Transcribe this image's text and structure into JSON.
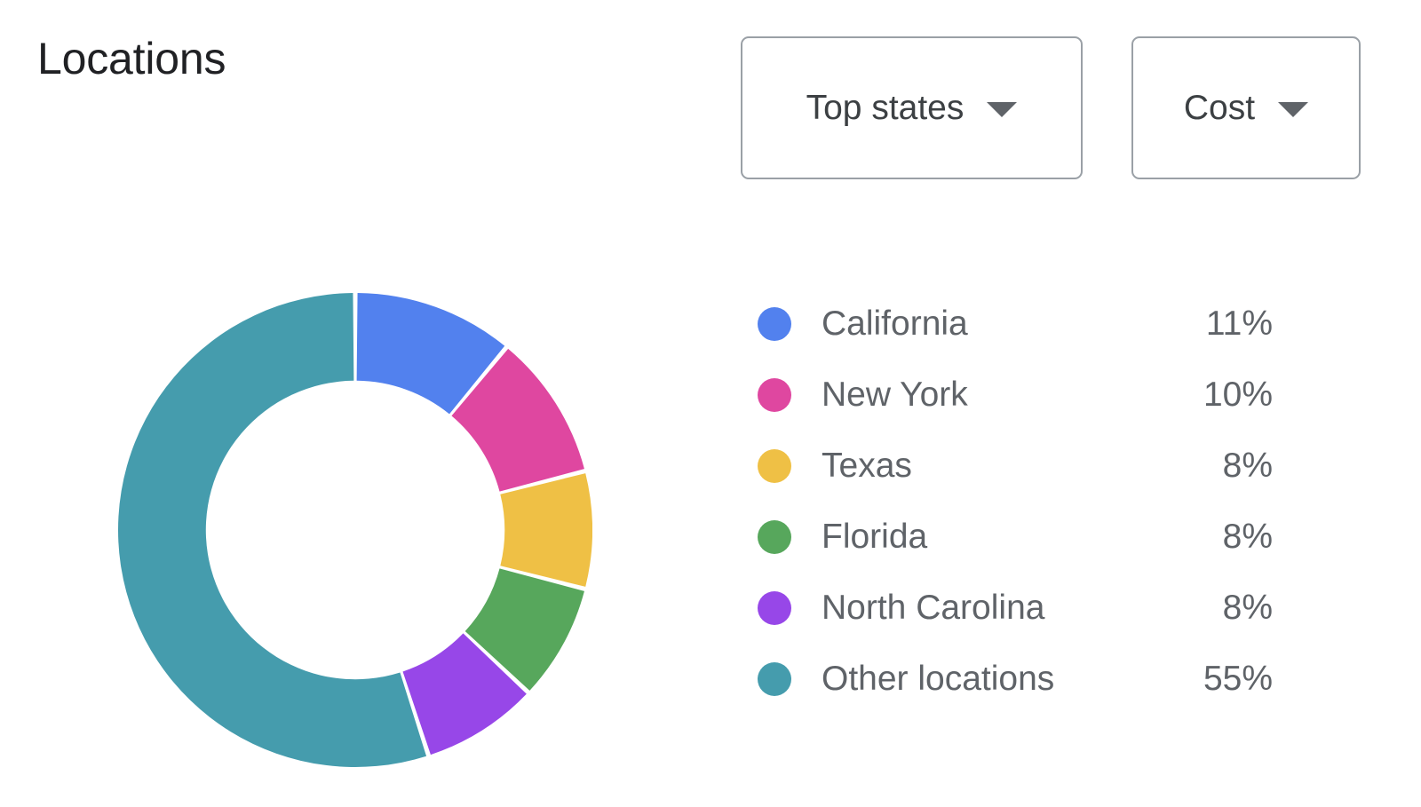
{
  "header": {
    "title": "Locations",
    "controls": [
      {
        "label": "Top states",
        "icon": "chevron-down-icon",
        "name": "top-states-dropdown"
      },
      {
        "label": "Cost",
        "icon": "chevron-down-icon",
        "name": "cost-dropdown"
      }
    ]
  },
  "colors": {
    "california": "#5281ee",
    "new_york": "#df47a0",
    "texas": "#efc045",
    "florida": "#57a75c",
    "north_carolina": "#9747e8",
    "other": "#459cad",
    "text": "#5f6368",
    "title": "#202124",
    "border": "#9aa0a6"
  },
  "chart_data": {
    "type": "pie",
    "title": "Locations",
    "subtitle": "",
    "variant": "donut",
    "units": "percent",
    "start_angle_deg": 0,
    "direction": "clockwise",
    "inner_radius_ratio": 0.63,
    "legend_position": "right",
    "grid": false,
    "categories": [
      "California",
      "New York",
      "Texas",
      "Florida",
      "North Carolina",
      "Other locations"
    ],
    "values": [
      11,
      10,
      8,
      8,
      8,
      55
    ],
    "value_labels": [
      "11%",
      "10%",
      "8%",
      "8%",
      "8%",
      "55%"
    ],
    "colors": [
      "#5281ee",
      "#df47a0",
      "#efc045",
      "#57a75c",
      "#9747e8",
      "#459cad"
    ],
    "slices": [
      {
        "label": "California",
        "value": 11,
        "display": "11%",
        "color": "#5281ee"
      },
      {
        "label": "New York",
        "value": 10,
        "display": "10%",
        "color": "#df47a0"
      },
      {
        "label": "Texas",
        "value": 8,
        "display": "8%",
        "color": "#efc045"
      },
      {
        "label": "Florida",
        "value": 8,
        "display": "8%",
        "color": "#57a75c"
      },
      {
        "label": "North Carolina",
        "value": 8,
        "display": "8%",
        "color": "#9747e8"
      },
      {
        "label": "Other locations",
        "value": 55,
        "display": "55%",
        "color": "#459cad"
      }
    ]
  },
  "legend": [
    {
      "label": "California",
      "value": "11%",
      "color": "#5281ee"
    },
    {
      "label": "New York",
      "value": "10%",
      "color": "#df47a0"
    },
    {
      "label": "Texas",
      "value": "8%",
      "color": "#efc045"
    },
    {
      "label": "Florida",
      "value": "8%",
      "color": "#57a75c"
    },
    {
      "label": "North Carolina",
      "value": "8%",
      "color": "#9747e8"
    },
    {
      "label": "Other locations",
      "value": "55%",
      "color": "#459cad"
    }
  ]
}
